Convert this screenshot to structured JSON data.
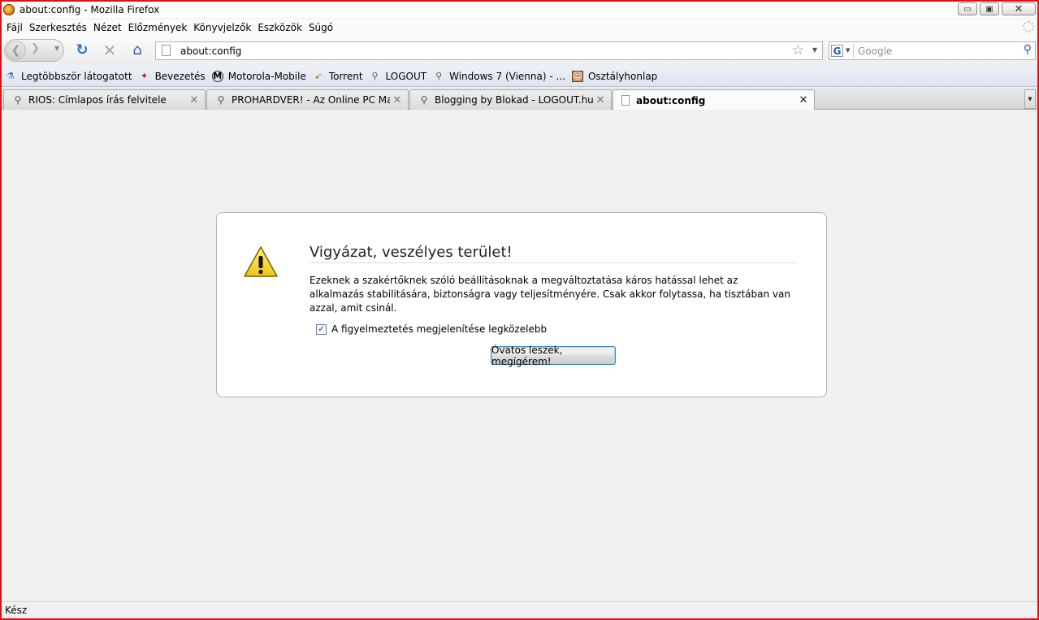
{
  "window": {
    "title": "about:config - Mozilla Firefox"
  },
  "menu": {
    "items": [
      "Fájl",
      "Szerkesztés",
      "Nézet",
      "Előzmények",
      "Könyvjelzők",
      "Eszközök",
      "Súgó"
    ]
  },
  "nav": {
    "url": "about:config",
    "search_placeholder": "Google"
  },
  "bookmarks": {
    "items": [
      {
        "label": "Legtöbbször látogatott",
        "icon": "smart-bookmark-icon"
      },
      {
        "label": "Bevezetés",
        "icon": "red-bird-icon"
      },
      {
        "label": "Motorola-Mobile",
        "icon": "motorola-icon"
      },
      {
        "label": "Torrent",
        "icon": "torrent-icon"
      },
      {
        "label": "LOGOUT",
        "icon": "magnifier-icon"
      },
      {
        "label": "Windows 7 (Vienna) - ...",
        "icon": "magnifier-icon"
      },
      {
        "label": "Osztályhonlap",
        "icon": "class-site-icon"
      }
    ]
  },
  "tabs": {
    "items": [
      {
        "label": "RIOS: Címlapos írás felvitele",
        "active": false
      },
      {
        "label": "PROHARDVER! - Az Online PC Mag...",
        "active": false
      },
      {
        "label": "Blogging by Blokad - LOGOUT.hu ...",
        "active": false
      },
      {
        "label": "about:config",
        "active": true
      }
    ]
  },
  "warning": {
    "title": "Vigyázat, veszélyes terület!",
    "text": "Ezeknek a szakértőknek szóló beállításoknak a megváltoztatása káros hatással lehet az alkalmazás stabilitására, biztonságra vagy teljesítményére. Csak akkor folytassa, ha tisztában van azzal, amit csinál.",
    "checkbox_label": "A figyelmeztetés megjelenítése legközelebb",
    "checkbox_checked": true,
    "button_label": "Óvatos leszek, megígérem!"
  },
  "status": {
    "text": "Kész"
  },
  "colors": {
    "window_border": "#e01010",
    "content_bg": "#f0f0f0",
    "warning_yellow": "#f5d718"
  }
}
